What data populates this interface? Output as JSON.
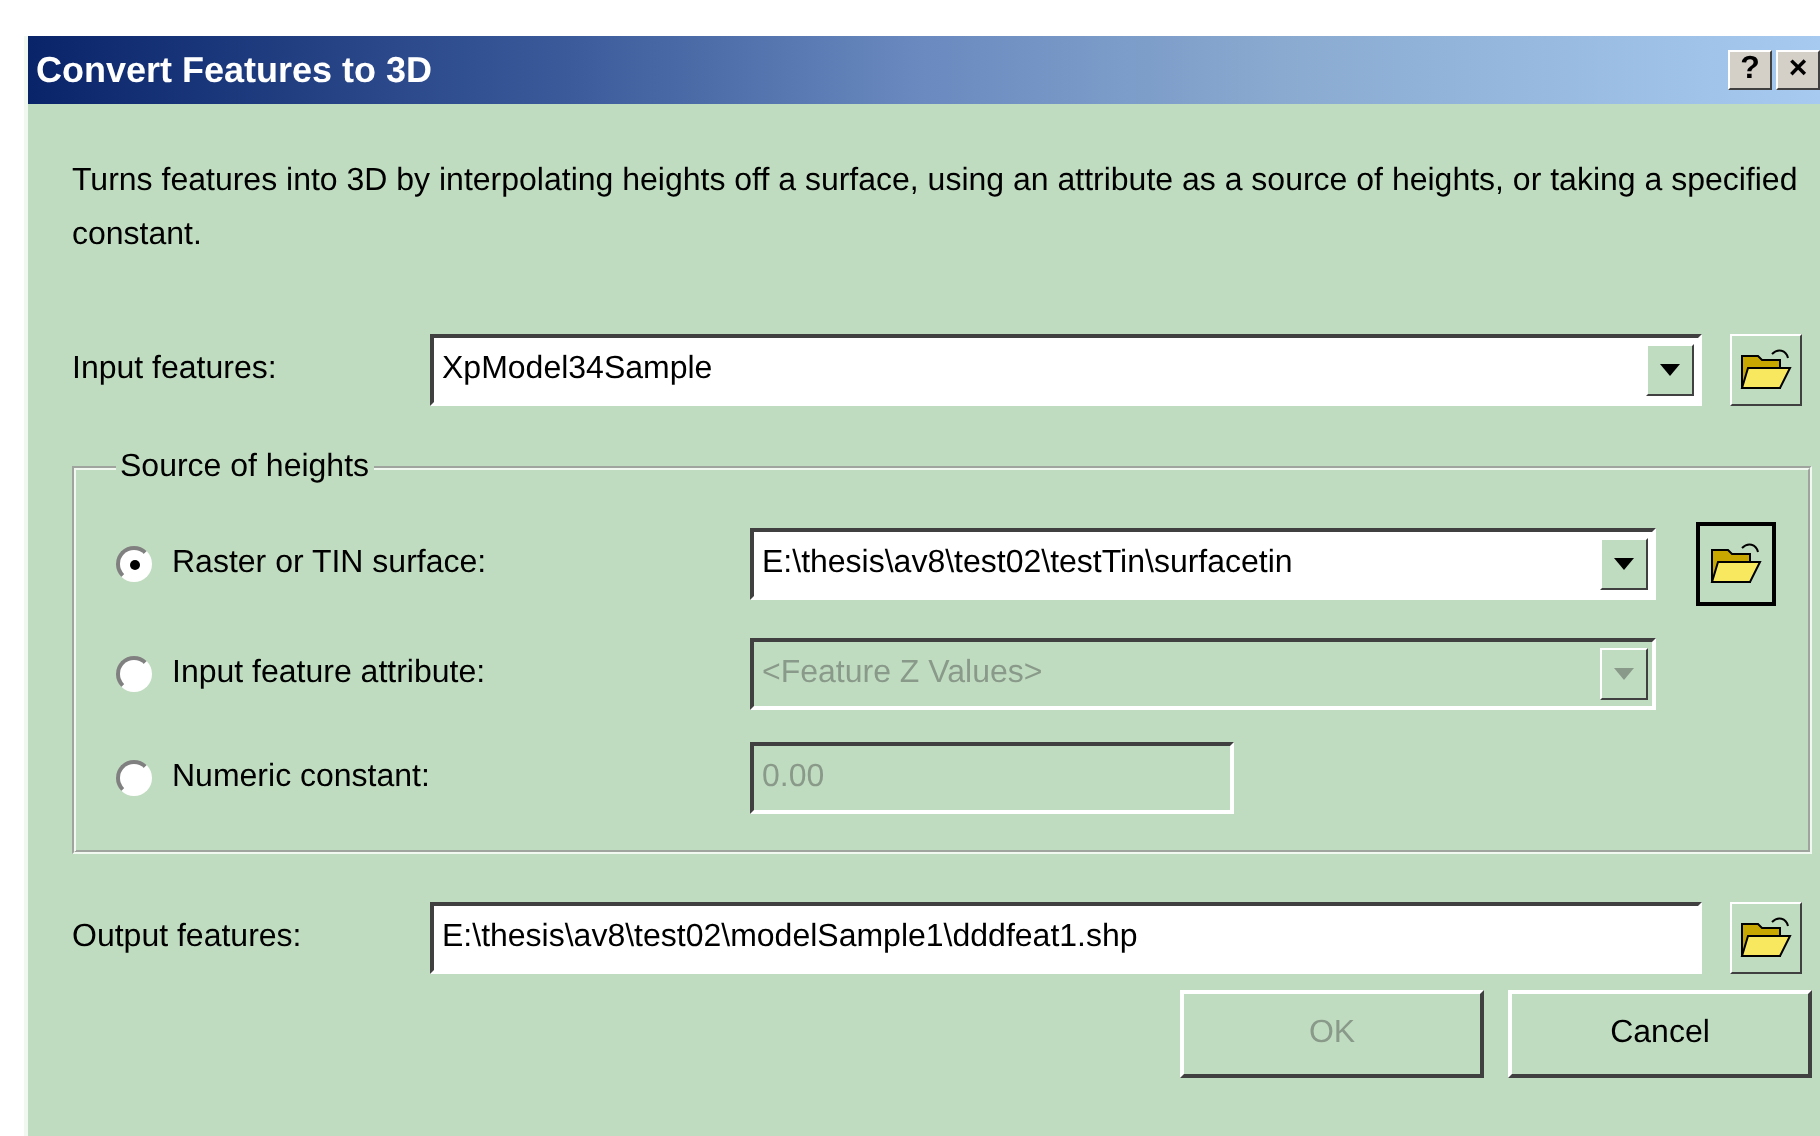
{
  "window": {
    "title": "Convert Features to 3D",
    "title_buttons": [
      "?",
      "×"
    ]
  },
  "description": "Turns features into 3D by interpolating heights off a surface, using an attribute as a source of heights, or taking a specified constant.",
  "input_features": {
    "label": "Input features:",
    "value": "XpModel34Sample"
  },
  "source_of_heights": {
    "legend": "Source of heights",
    "options": [
      {
        "label": "Raster or TIN surface:",
        "selected": true,
        "field": {
          "kind": "dropdown",
          "value": "E:\\thesis\\av8\\test02\\testTin\\surfacetin",
          "disabled": false,
          "browse_button": true
        }
      },
      {
        "label": "Input feature attribute:",
        "selected": false,
        "field": {
          "kind": "dropdown",
          "value": "<Feature Z Values>",
          "disabled": true,
          "browse_button": false
        }
      },
      {
        "label": "Numeric constant:",
        "selected": false,
        "field": {
          "kind": "text",
          "value": "0.00",
          "disabled": true,
          "browse_button": false
        }
      }
    ]
  },
  "output_features": {
    "label": "Output features:",
    "value": "E:\\thesis\\av8\\test02\\modelSample1\\dddfeat1.shp"
  },
  "buttons": [
    {
      "label": "OK",
      "disabled": true
    },
    {
      "label": "Cancel",
      "disabled": false
    }
  ]
}
